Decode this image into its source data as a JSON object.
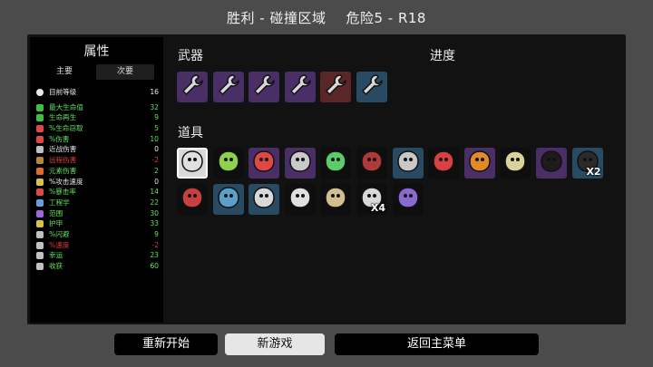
{
  "header": {
    "result": "胜利 - 碰撞区域",
    "danger": "危险5 - R18"
  },
  "stats": {
    "title": "属性",
    "tabs": [
      "主要",
      "次要"
    ],
    "level": {
      "label": "目前等级",
      "value": "16"
    },
    "rows": [
      {
        "label": "最大生命值",
        "value": "32",
        "tone": "pos",
        "icon": "heart-icon",
        "color": "#3fbf3f"
      },
      {
        "label": "生命再生",
        "value": "9",
        "tone": "pos",
        "icon": "heart-plus-icon",
        "color": "#3fbf3f"
      },
      {
        "label": "%生命窃取",
        "value": "5",
        "tone": "pos",
        "icon": "blood-drop-icon",
        "color": "#d94a4a"
      },
      {
        "label": "%伤害",
        "value": "10",
        "tone": "pos",
        "icon": "fist-icon",
        "color": "#d94a4a"
      },
      {
        "label": "近战伤害",
        "value": "0",
        "tone": "neutral",
        "icon": "sword-icon",
        "color": "#c0c0c0"
      },
      {
        "label": "远程伤害",
        "value": "-2",
        "tone": "neg",
        "icon": "bow-icon",
        "color": "#b8863b"
      },
      {
        "label": "元素伤害",
        "value": "2",
        "tone": "pos",
        "icon": "flame-icon",
        "color": "#e06a2a"
      },
      {
        "label": "%攻击速度",
        "value": "0",
        "tone": "neutral",
        "icon": "hourglass-icon",
        "color": "#d9c14a"
      },
      {
        "label": "%暴击率",
        "value": "14",
        "tone": "pos",
        "icon": "crit-icon",
        "color": "#d94a4a"
      },
      {
        "label": "工程学",
        "value": "22",
        "tone": "pos",
        "icon": "wrench-cross-icon",
        "color": "#6aa0d9"
      },
      {
        "label": "范围",
        "value": "30",
        "tone": "pos",
        "icon": "range-icon",
        "color": "#9a6ad9"
      },
      {
        "label": "护甲",
        "value": "33",
        "tone": "pos",
        "icon": "shield-icon",
        "color": "#d9c14a"
      },
      {
        "label": "%闪避",
        "value": "9",
        "tone": "pos",
        "icon": "dodge-icon",
        "color": "#c0c0c0"
      },
      {
        "label": "%速度",
        "value": "-2",
        "tone": "neg",
        "icon": "speed-icon",
        "color": "#c0c0c0"
      },
      {
        "label": "幸运",
        "value": "23",
        "tone": "pos",
        "icon": "clover-icon",
        "color": "#c0c0c0"
      },
      {
        "label": "收获",
        "value": "60",
        "tone": "pos",
        "icon": "harvest-icon",
        "color": "#c0c0c0"
      }
    ]
  },
  "weapons": {
    "title": "武器",
    "items": [
      {
        "name": "wrench-icon",
        "tier": "purple"
      },
      {
        "name": "wrench-icon",
        "tier": "purple"
      },
      {
        "name": "wrench-icon",
        "tier": "purple"
      },
      {
        "name": "wrench-icon",
        "tier": "purple"
      },
      {
        "name": "wrench-icon",
        "tier": "red"
      },
      {
        "name": "wrench-icon",
        "tier": "blue"
      }
    ]
  },
  "progress": {
    "title": "进度"
  },
  "items": {
    "title": "道具",
    "list": [
      {
        "name": "egg-character-icon",
        "tier": "white",
        "qty": ""
      },
      {
        "name": "jar-icon",
        "tier": "black",
        "qty": ""
      },
      {
        "name": "fuel-can-icon",
        "tier": "purple",
        "qty": ""
      },
      {
        "name": "rat-icon",
        "tier": "purple",
        "qty": ""
      },
      {
        "name": "snake-icon",
        "tier": "black",
        "qty": ""
      },
      {
        "name": "jacket-icon",
        "tier": "black",
        "qty": ""
      },
      {
        "name": "rock-creature-icon",
        "tier": "blue",
        "qty": ""
      },
      {
        "name": "syringe-icon",
        "tier": "black",
        "qty": ""
      },
      {
        "name": "alien-eye-icon",
        "tier": "purple",
        "qty": ""
      },
      {
        "name": "cash-scroll-icon",
        "tier": "black",
        "qty": ""
      },
      {
        "name": "bag-icon",
        "tier": "purple",
        "qty": ""
      },
      {
        "name": "backpack-icon",
        "tier": "blue",
        "qty": "X2"
      },
      {
        "name": "spinning-top-icon",
        "tier": "black",
        "qty": ""
      },
      {
        "name": "ring-icon",
        "tier": "blue",
        "qty": ""
      },
      {
        "name": "dumbbell-icon",
        "tier": "blue",
        "qty": ""
      },
      {
        "name": "skull-claw-icon",
        "tier": "black",
        "qty": ""
      },
      {
        "name": "snail-icon",
        "tier": "black",
        "qty": ""
      },
      {
        "name": "speaker-icon",
        "tier": "black",
        "qty": "X4"
      },
      {
        "name": "mushroom-icon",
        "tier": "black",
        "qty": ""
      }
    ]
  },
  "buttons": {
    "restart": "重新开始",
    "new_game": "新游戏",
    "main_menu": "返回主菜单"
  }
}
